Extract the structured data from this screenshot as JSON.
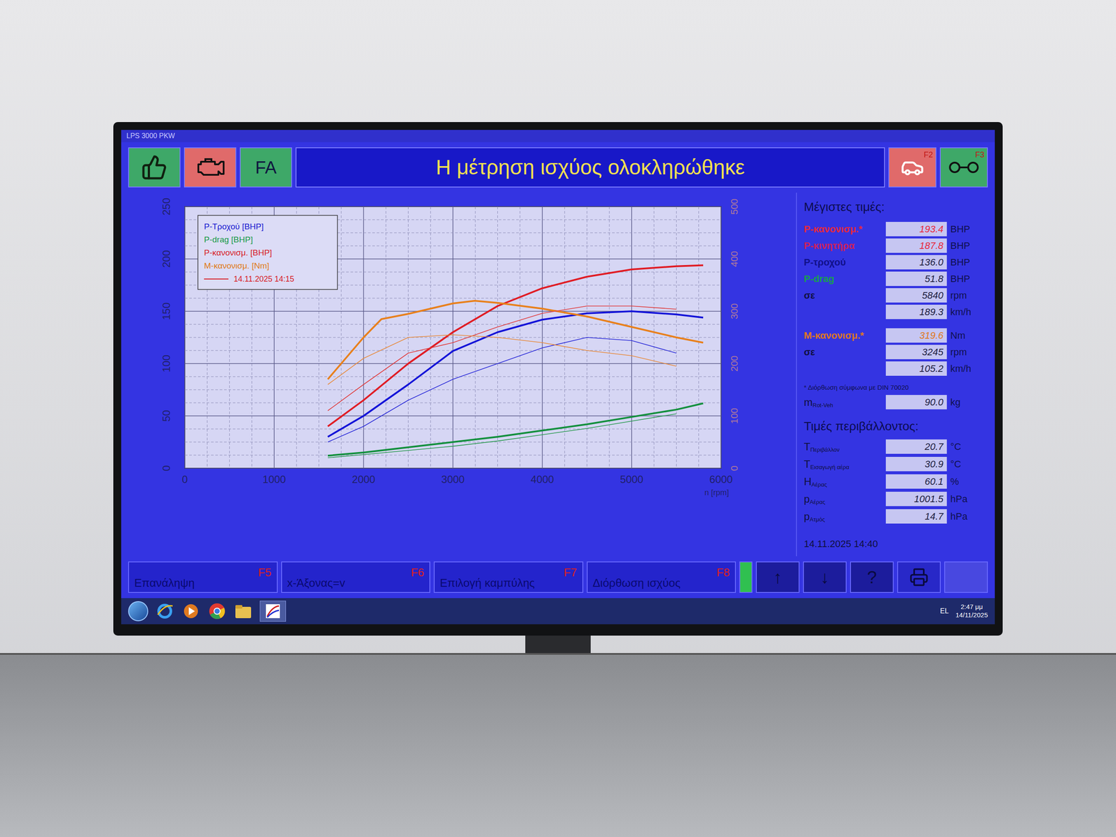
{
  "window": {
    "title": "LPS 3000 PKW"
  },
  "toolbar": {
    "status_text": "FA",
    "banner": "Η μέτρηση ισχύος ολοκληρώθηκε",
    "right_keys": [
      "F2",
      "F3"
    ]
  },
  "chart": {
    "y_ticks": [
      "0",
      "50",
      "100",
      "150",
      "200",
      "250"
    ],
    "y2_ticks": [
      "0",
      "100",
      "200",
      "300",
      "400",
      "500"
    ],
    "x_ticks": [
      "0",
      "1000",
      "2000",
      "3000",
      "4000",
      "5000",
      "6000"
    ],
    "x_unit": "n [rpm]",
    "legend": [
      {
        "label": "P-Τροχού [BHP]",
        "color": "#1a1ad0"
      },
      {
        "label": "P-drag [BHP]",
        "color": "#189a48"
      },
      {
        "label": "P-κανονισμ. [BHP]",
        "color": "#d81c28"
      },
      {
        "label": "M-κανονισμ. [Nm]",
        "color": "#e07a18"
      }
    ],
    "legend_run": {
      "label": "14.11.2025 14:15",
      "color": "#d81c28"
    },
    "series": [
      {
        "name": "P-κανονισμ.",
        "kind": "current",
        "axis": "left",
        "color": "#e01c24",
        "rpm": [
          1600,
          2000,
          2500,
          3000,
          3500,
          4000,
          4500,
          5000,
          5500,
          5800
        ],
        "values": [
          40,
          65,
          100,
          130,
          155,
          172,
          183,
          190,
          193,
          194
        ]
      },
      {
        "name": "P-Τροχού",
        "kind": "current",
        "axis": "left",
        "color": "#1414d8",
        "rpm": [
          1600,
          2000,
          2500,
          3000,
          3500,
          4000,
          4500,
          5000,
          5500,
          5800
        ],
        "values": [
          30,
          50,
          80,
          112,
          130,
          142,
          148,
          150,
          147,
          144
        ]
      },
      {
        "name": "P-drag",
        "kind": "current",
        "axis": "left",
        "color": "#14903e",
        "rpm": [
          1600,
          2000,
          2500,
          3000,
          3500,
          4000,
          4500,
          5000,
          5500,
          5800
        ],
        "values": [
          12,
          15,
          20,
          25,
          30,
          36,
          42,
          49,
          56,
          62
        ]
      },
      {
        "name": "M-κανονισμ.",
        "kind": "current",
        "axis": "right",
        "color": "#e8801c",
        "rpm": [
          1600,
          2000,
          2200,
          2500,
          3000,
          3245,
          3500,
          4000,
          4500,
          5000,
          5500,
          5800
        ],
        "values": [
          170,
          250,
          285,
          295,
          315,
          320,
          316,
          305,
          290,
          270,
          250,
          240
        ]
      },
      {
        "name": "P-κανονισμ.",
        "kind": "previous",
        "axis": "left",
        "color": "#e03a3a",
        "rpm": [
          1600,
          2000,
          2500,
          3000,
          3500,
          4000,
          4500,
          5000,
          5500
        ],
        "values": [
          55,
          80,
          110,
          120,
          135,
          148,
          155,
          155,
          152
        ]
      },
      {
        "name": "P-Τροχού",
        "kind": "previous",
        "axis": "left",
        "color": "#2a2ad8",
        "rpm": [
          1600,
          2000,
          2500,
          3000,
          3500,
          4000,
          4500,
          5000,
          5500
        ],
        "values": [
          25,
          40,
          65,
          85,
          100,
          115,
          125,
          122,
          110
        ]
      },
      {
        "name": "P-drag",
        "kind": "previous",
        "axis": "left",
        "color": "#2a9a50",
        "rpm": [
          1600,
          2000,
          2500,
          3000,
          3500,
          4000,
          4500,
          5000,
          5500
        ],
        "values": [
          10,
          13,
          17,
          21,
          26,
          32,
          38,
          45,
          52
        ]
      },
      {
        "name": "M-κανονισμ.",
        "kind": "previous",
        "axis": "right",
        "color": "#e88a3a",
        "rpm": [
          1600,
          2000,
          2500,
          3000,
          3500,
          4000,
          4500,
          5000,
          5500
        ],
        "values": [
          160,
          210,
          250,
          255,
          250,
          240,
          225,
          215,
          195
        ]
      }
    ]
  },
  "max_values": {
    "title": "Μέγιστες τιμές:",
    "power_rows": [
      {
        "label": "P-κανονισμ.*",
        "value": "193.4",
        "unit": "BHP",
        "color": "#e8283c",
        "value_color": "#e8283c"
      },
      {
        "label": "P-κινητήρα",
        "value": "187.8",
        "unit": "BHP",
        "color": "#d0205a",
        "value_color": "#e8283c"
      },
      {
        "label": "P-τροχού",
        "value": "136.0",
        "unit": "BHP",
        "color": "#10108a",
        "value_color": "#202040"
      },
      {
        "label": "P-drag",
        "value": "51.8",
        "unit": "BHP",
        "color": "#18a050",
        "value_color": "#202040"
      },
      {
        "label": "σε",
        "value": "5840",
        "unit": "rpm",
        "color": "#101040",
        "value_color": "#202040"
      },
      {
        "label": "",
        "value": "189.3",
        "unit": "km/h",
        "color": "#101040",
        "value_color": "#202040"
      }
    ],
    "torque_rows": [
      {
        "label": "M-κανονισμ.*",
        "value": "319.6",
        "unit": "Nm",
        "color": "#e07820",
        "value_color": "#e07820"
      },
      {
        "label": "σε",
        "value": "3245",
        "unit": "rpm",
        "color": "#101040",
        "value_color": "#202040"
      },
      {
        "label": "",
        "value": "105.2",
        "unit": "km/h",
        "color": "#101040",
        "value_color": "#202040"
      }
    ],
    "note": "* Διόρθωση σύμφωνα με DIN 70020",
    "mass": {
      "symbol": "m",
      "sub": "Rot-Veh",
      "value": "90.0",
      "unit": "kg"
    }
  },
  "environment": {
    "title": "Τιμές περιβάλλοντος:",
    "rows": [
      {
        "symbol": "T",
        "sub": "Περιβάλλον",
        "value": "20.7",
        "unit": "°C"
      },
      {
        "symbol": "T",
        "sub": "Εισαγωγή αέρα",
        "value": "30.9",
        "unit": "°C"
      },
      {
        "symbol": "H",
        "sub": "Αέρας",
        "value": "60.1",
        "unit": "%"
      },
      {
        "symbol": "p",
        "sub": "Αέρας",
        "value": "1001.5",
        "unit": "hPa"
      },
      {
        "symbol": "p",
        "sub": "Ατμός",
        "value": "14.7",
        "unit": "hPa"
      }
    ]
  },
  "timestamp": "14.11.2025 14:40",
  "function_keys": [
    {
      "key": "F5",
      "label": "Επανάληψη"
    },
    {
      "key": "F6",
      "label": "x-Άξονας=v"
    },
    {
      "key": "F7",
      "label": "Επιλογή καμπύλης"
    },
    {
      "key": "F8",
      "label": "Διόρθωση ισχύος"
    }
  ],
  "indicator": {
    "on": true
  },
  "nav_buttons": [
    "↑",
    "↓",
    "?"
  ],
  "taskbar": {
    "lang": "EL",
    "time": "2:47 μμ",
    "date": "14/11/2025"
  }
}
